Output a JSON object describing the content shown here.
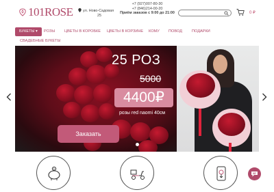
{
  "header": {
    "logo_text": "101ROSE",
    "address_line1": "ул. Ново-Садовая",
    "address_line2": "25",
    "phone1": "+7 (927)007-80-30",
    "phone2": "+7 (846)214-00-20",
    "hours": "Приём заказов с 9:00 до 21:00",
    "search": {
      "placeholder": ""
    },
    "cart_total": "0 ₽"
  },
  "nav": {
    "items": [
      {
        "label": "БУКЕТЫ ▾"
      },
      {
        "label": "РОЗЫ"
      },
      {
        "label": "ЦВЕТЫ В КОРОБКЕ"
      },
      {
        "label": "ЦВЕТЫ В КОРЗИНЕ"
      },
      {
        "label": "КОМУ"
      },
      {
        "label": "ПОВОД"
      },
      {
        "label": "ПОДАРКИ"
      },
      {
        "label": "СВАДЕБНЫЕ БУКЕТЫ"
      }
    ]
  },
  "banner": {
    "title": "25 РОЗ",
    "old_price": "5000",
    "new_price": "4400₽",
    "caption": "розы red naomi 40см",
    "order_button": "Заказать",
    "slide_index": 1
  },
  "features": [
    {
      "icon": "piggy-bank-icon"
    },
    {
      "icon": "delivery-scooter-icon"
    },
    {
      "icon": "flower-gift-icon"
    }
  ],
  "colors": {
    "brand": "#b04a6a",
    "price_badge": "#d98ca0",
    "button": "#c25a79"
  }
}
